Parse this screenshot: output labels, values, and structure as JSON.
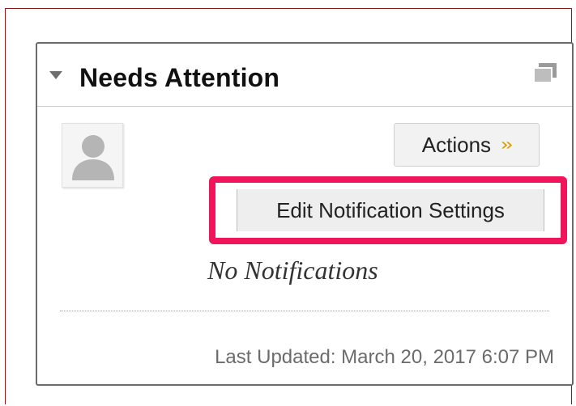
{
  "module": {
    "title": "Needs Attention",
    "actions_label": "Actions",
    "edit_notifications_label": "Edit Notification Settings",
    "empty_message": "No Notifications",
    "last_updated": "Last Updated: March 20, 2017 6:07 PM"
  },
  "icons": {
    "collapse": "triangle-down-icon",
    "window": "window-icon",
    "avatar": "user-silhouette-icon",
    "actions_chevron": "double-chevron-down-icon"
  },
  "colors": {
    "highlight": "#f0155a",
    "chevron": "#d79b00",
    "frame_border": "#8b1a1a"
  }
}
